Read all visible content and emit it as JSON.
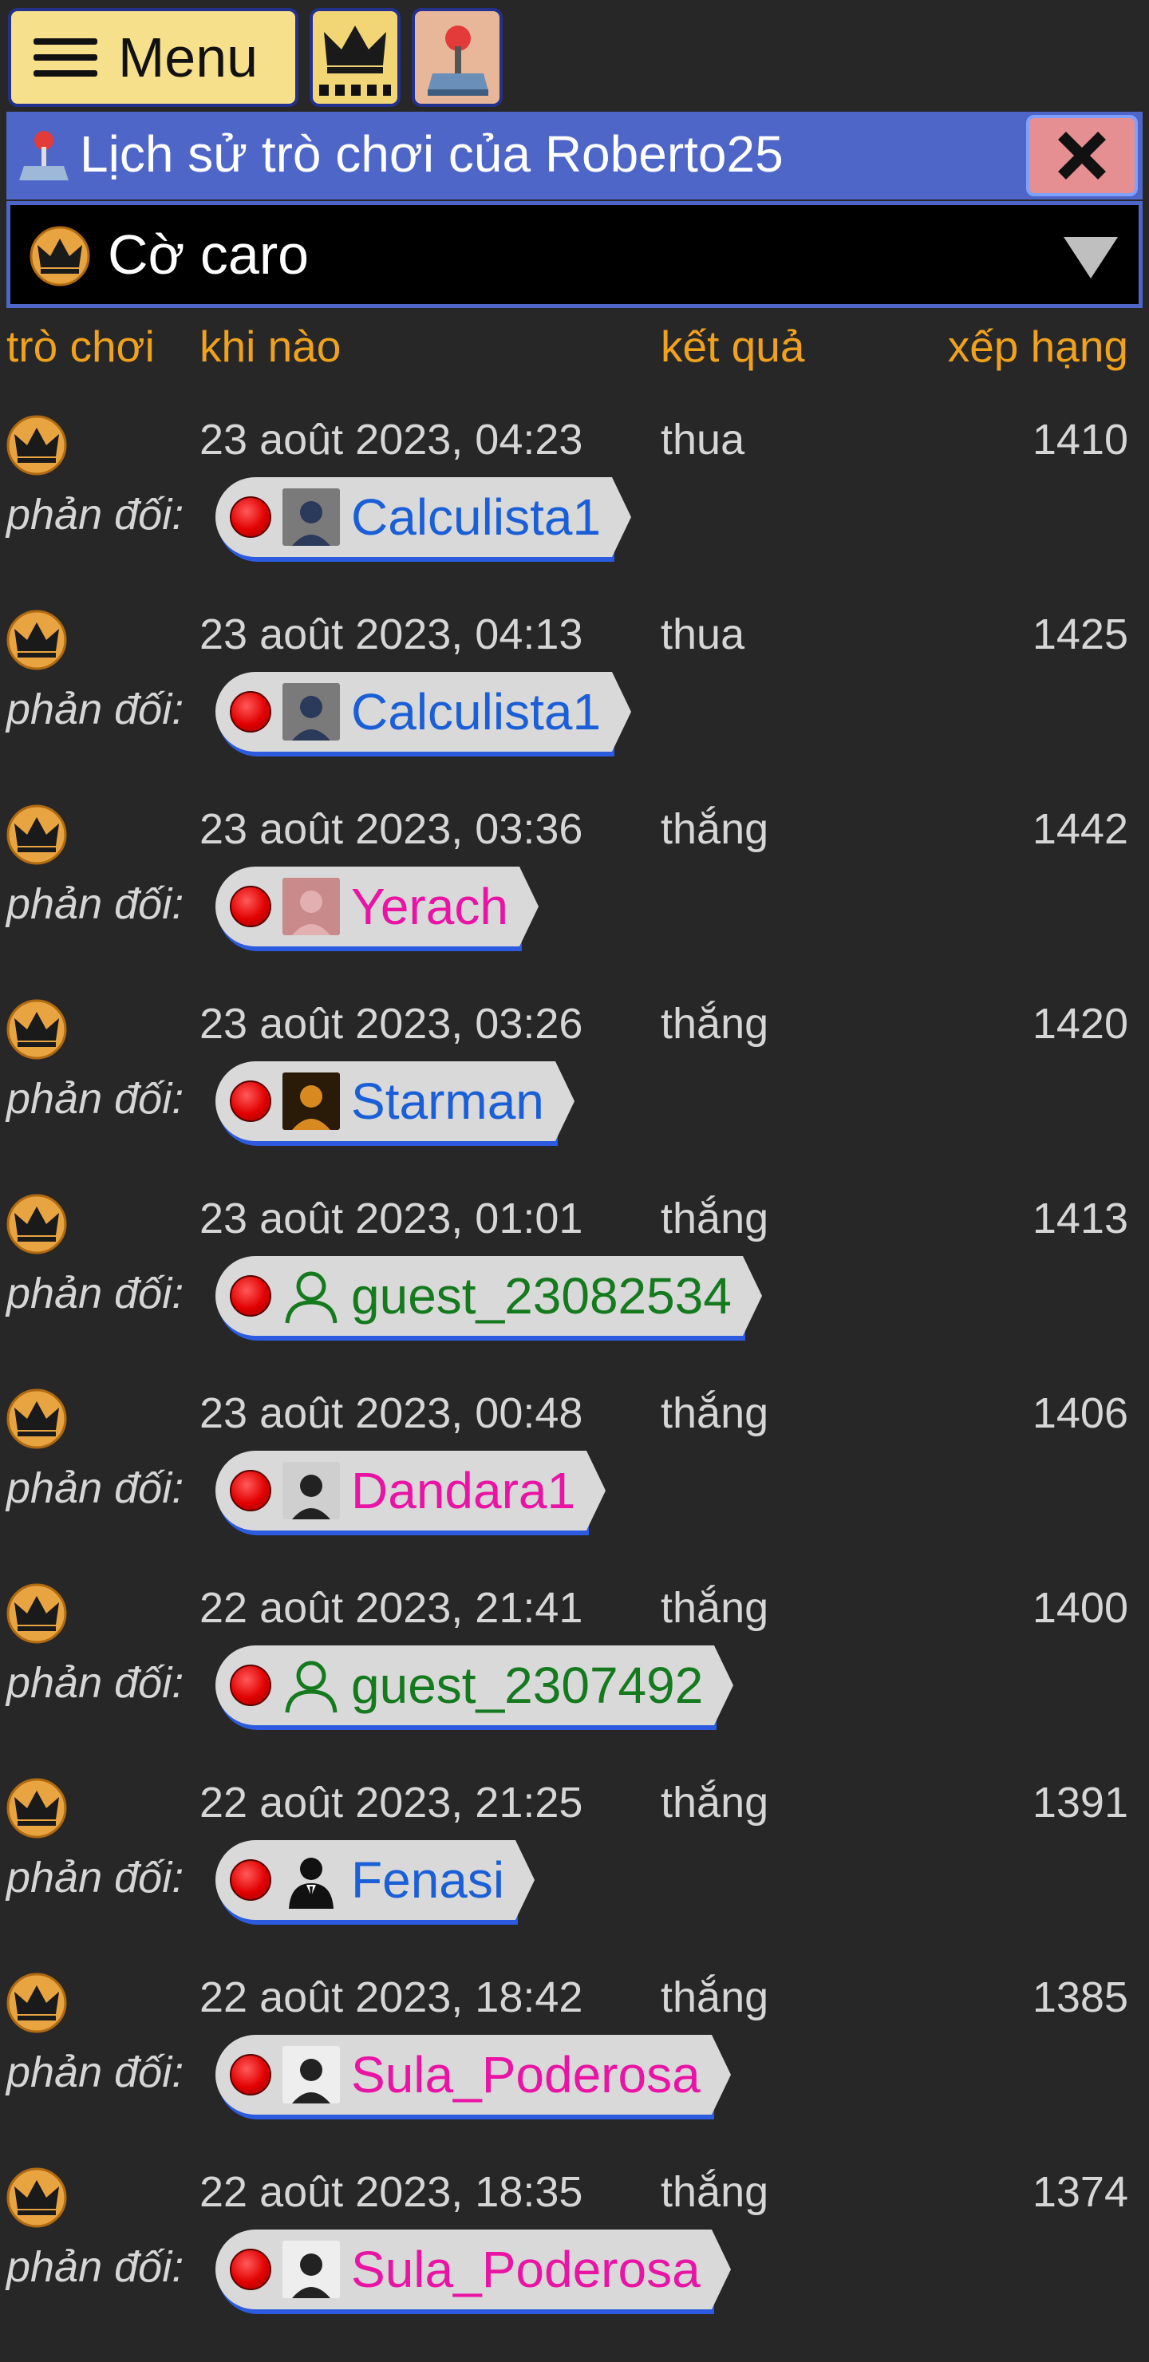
{
  "toolbar": {
    "menu_label": "Menu"
  },
  "title": {
    "text": "Lịch sử trò chơi của Roberto25"
  },
  "game_select": {
    "selected": "Cờ caro"
  },
  "columns": {
    "game": "trò chơi",
    "when": "khi nào",
    "result": "kết quả",
    "rank": "xếp hạng"
  },
  "opponent_label": "phản đối:",
  "games": [
    {
      "when": "23 août 2023, 04:23",
      "result": "thua",
      "rank": "1410",
      "opponent": "Calculista1",
      "name_color": "#1a5fd8",
      "avatar": "photo-avatar"
    },
    {
      "when": "23 août 2023, 04:13",
      "result": "thua",
      "rank": "1425",
      "opponent": "Calculista1",
      "name_color": "#1a5fd8",
      "avatar": "photo-avatar"
    },
    {
      "when": "23 août 2023, 03:36",
      "result": "thắng",
      "rank": "1442",
      "opponent": "Yerach",
      "name_color": "#ea14a4",
      "avatar": "photo-avatar"
    },
    {
      "when": "23 août 2023, 03:26",
      "result": "thắng",
      "rank": "1420",
      "opponent": "Starman",
      "name_color": "#1a5fd8",
      "avatar": "photo-avatar"
    },
    {
      "when": "23 août 2023, 01:01",
      "result": "thắng",
      "rank": "1413",
      "opponent": "guest_23082534",
      "name_color": "#157a1e",
      "avatar": "guest-user-icon"
    },
    {
      "when": "23 août 2023, 00:48",
      "result": "thắng",
      "rank": "1406",
      "opponent": "Dandara1",
      "name_color": "#ea14a4",
      "avatar": "photo-avatar"
    },
    {
      "when": "22 août 2023, 21:41",
      "result": "thắng",
      "rank": "1400",
      "opponent": "guest_2307492",
      "name_color": "#157a1e",
      "avatar": "guest-user-icon"
    },
    {
      "when": "22 août 2023, 21:25",
      "result": "thắng",
      "rank": "1391",
      "opponent": "Fenasi",
      "name_color": "#1a5fd8",
      "avatar": "businessman-icon"
    },
    {
      "when": "22 août 2023, 18:42",
      "result": "thắng",
      "rank": "1385",
      "opponent": "Sula_Poderosa",
      "name_color": "#ea14a4",
      "avatar": "photo-avatar"
    },
    {
      "when": "22 août 2023, 18:35",
      "result": "thắng",
      "rank": "1374",
      "opponent": "Sula_Poderosa",
      "name_color": "#ea14a4",
      "avatar": "photo-avatar"
    }
  ]
}
